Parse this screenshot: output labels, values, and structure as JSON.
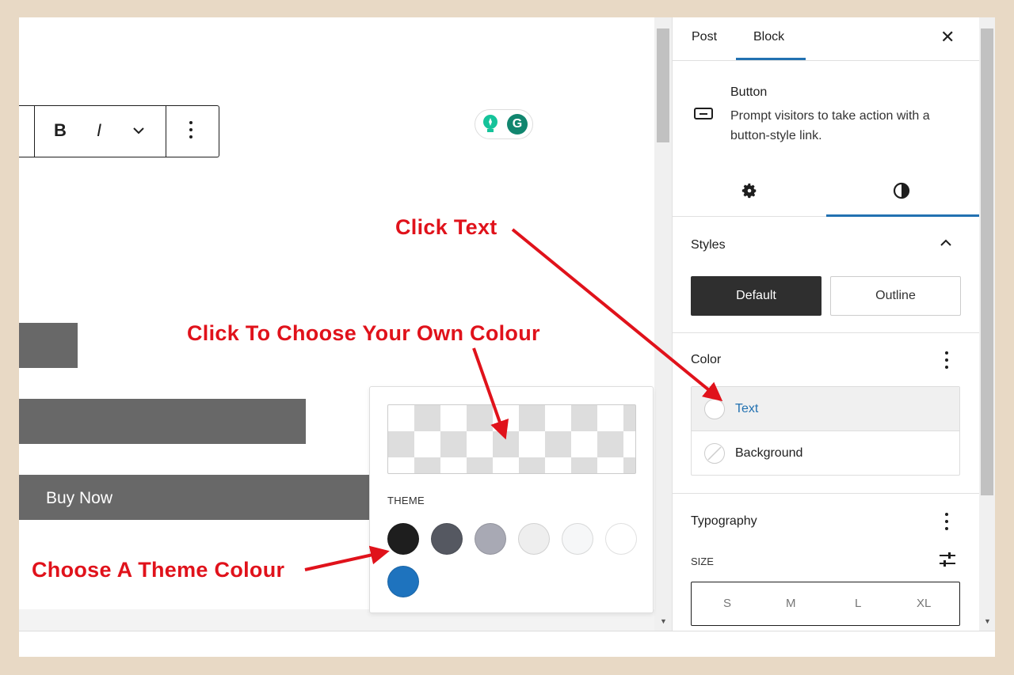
{
  "toolbar": {
    "bold": "B",
    "italic": "I",
    "more_icon": "chevron-down-icon",
    "options_icon": "vertical-ellipsis-icon"
  },
  "editor": {
    "button_text": "Buy Now"
  },
  "popover": {
    "theme_label": "THEME",
    "swatches": [
      "#1e1e1e",
      "#555861",
      "#a8a9b4",
      "#eeeeee",
      "#f6f7f8",
      "#ffffff",
      "#1e73be"
    ]
  },
  "sidebar": {
    "tabs": [
      "Post",
      "Block"
    ],
    "active_tab": "Block",
    "block": {
      "name": "Button",
      "description": "Prompt visitors to take action with a button-style link."
    },
    "subtabs": [
      "settings-gear-icon",
      "styles-contrast-icon"
    ],
    "styles": {
      "title": "Styles",
      "options": [
        "Default",
        "Outline"
      ],
      "selected": "Default"
    },
    "color": {
      "title": "Color",
      "items": [
        "Text",
        "Background"
      ]
    },
    "typography": {
      "title": "Typography",
      "size_label": "SIZE",
      "sizes": [
        "S",
        "M",
        "L",
        "XL"
      ]
    }
  },
  "annotations": {
    "click_text": "Click Text",
    "choose_own": "Click To Choose Your Own Colour",
    "choose_theme": "Choose A Theme Colour",
    "color": "#e0121b"
  }
}
